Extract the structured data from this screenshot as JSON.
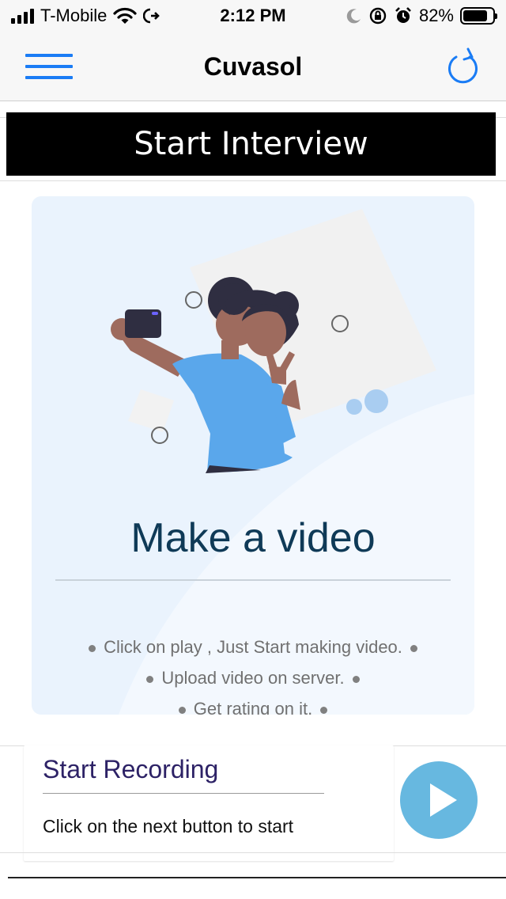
{
  "status_bar": {
    "carrier": "T-Mobile",
    "time": "2:12 PM",
    "battery": "82%",
    "battery_level": 0.82,
    "icons": [
      "signal-icon",
      "wifi-icon",
      "call-forwarding-icon",
      "moon-icon",
      "rotation-lock-icon",
      "alarm-icon",
      "battery-icon"
    ]
  },
  "nav": {
    "title": "Cuvasol",
    "menu_icon": "hamburger-menu-icon",
    "refresh_icon": "refresh-icon"
  },
  "banner": {
    "label": "Start Interview"
  },
  "card": {
    "title": "Make a video",
    "bullets": [
      "Click on play , Just Start making video.",
      "Upload video on server.",
      "Get rating on it."
    ],
    "illustration": "selfie-illustration"
  },
  "recording": {
    "title": "Start Recording",
    "subtitle": "Click on the next button to start",
    "play_icon": "play-icon"
  },
  "colors": {
    "accent": "#1a7cf5",
    "banner_bg": "#000000",
    "card_bg": "#eaf3fd",
    "card_title": "#0f3a57",
    "rec_title": "#2d2266",
    "play_button": "#67b8e0"
  }
}
